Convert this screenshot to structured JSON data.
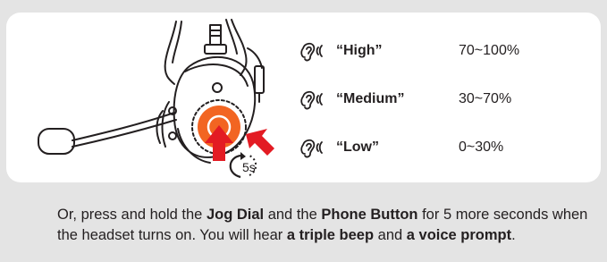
{
  "levels": [
    {
      "name": "“High”",
      "range": "70~100%"
    },
    {
      "name": "“Medium”",
      "range": "30~70%"
    },
    {
      "name": "“Low”",
      "range": "0~30%"
    }
  ],
  "illustration": {
    "timer_label": "5s"
  },
  "colors": {
    "accent": "#f26522",
    "arrow": "#e31b23",
    "panel": "#ffffff",
    "background": "#e4e4e4"
  },
  "icons": [
    "ear-sound-icon",
    "press-arrow-icon",
    "hold-timer-icon",
    "headset-illustration"
  ],
  "caption": {
    "t1": "Or, press and hold the ",
    "b1": "Jog Dial",
    "t2": " and the ",
    "b2": "Phone Button",
    "t3": " for 5 more seconds when the headset turns on. You will hear ",
    "b3": "a triple beep",
    "t4": " and ",
    "b4": "a voice prompt",
    "t5": "."
  }
}
